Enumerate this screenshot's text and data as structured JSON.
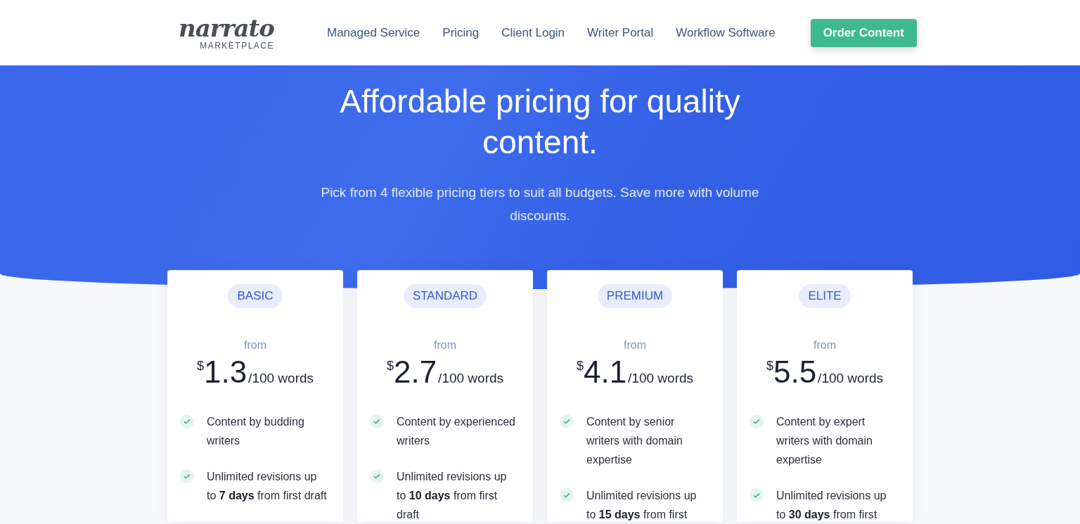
{
  "header": {
    "logo": {
      "script": "narrato",
      "tagline": "MARKETPLACE"
    },
    "nav": [
      "Managed Service",
      "Pricing",
      "Client Login",
      "Writer Portal",
      "Workflow Software"
    ],
    "cta": "Order Content"
  },
  "hero": {
    "title": "Affordable pricing for quality content.",
    "subtitle": "Pick from 4 flexible pricing tiers to suit all budgets. Save more with volume discounts."
  },
  "plans": [
    {
      "tier": "BASIC",
      "from": "from",
      "currency": "$",
      "price": "1.3",
      "unit": "/100 words",
      "features": [
        "Content by budding writers",
        "Unlimited revisions up to **7 days** from first draft"
      ]
    },
    {
      "tier": "STANDARD",
      "from": "from",
      "currency": "$",
      "price": "2.7",
      "unit": "/100 words",
      "features": [
        "Content by experienced writers",
        "Unlimited revisions up to **10 days** from first draft"
      ]
    },
    {
      "tier": "PREMIUM",
      "from": "from",
      "currency": "$",
      "price": "4.1",
      "unit": "/100 words",
      "features": [
        "Content by senior writers with domain expertise",
        "Unlimited revisions up to **15 days** from first"
      ]
    },
    {
      "tier": "ELITE",
      "from": "from",
      "currency": "$",
      "price": "5.5",
      "unit": "/100 words",
      "features": [
        "Content by expert writers with domain expertise",
        "Unlimited revisions up to **30 days** from first"
      ]
    }
  ]
}
